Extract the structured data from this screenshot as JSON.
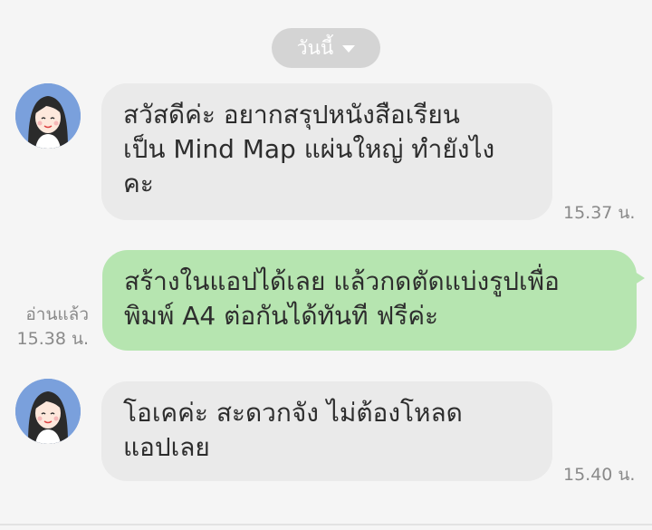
{
  "date_separator": {
    "label": "วันนี้",
    "icon": "caret-down-icon"
  },
  "messages": [
    {
      "sender": "other",
      "lines": [
        "สวัสดีค่ะ อยากสรุปหนังสือเรียน",
        "เป็น Mind Map แผ่นใหญ่ ทำยังไง",
        "คะ"
      ],
      "time": "15.37 น."
    },
    {
      "sender": "me",
      "lines": [
        "สร้างในแอปได้เลย แล้วกดตัดแบ่งรูปเพื่อ",
        "พิมพ์ A4 ต่อกันได้ทันที ฟรีค่ะ"
      ],
      "read_status": "อ่านแล้ว",
      "time": "15.38 น."
    },
    {
      "sender": "other",
      "lines": [
        "โอเคค่ะ สะดวกจัง ไม่ต้องโหลด",
        "แอปเลย"
      ],
      "time": "15.40 น."
    }
  ],
  "colors": {
    "incoming_bubble": "#eaeaea",
    "outgoing_bubble": "#b6e5b0",
    "avatar_bg": "#7aa0dc",
    "background": "#f5f5f5"
  }
}
